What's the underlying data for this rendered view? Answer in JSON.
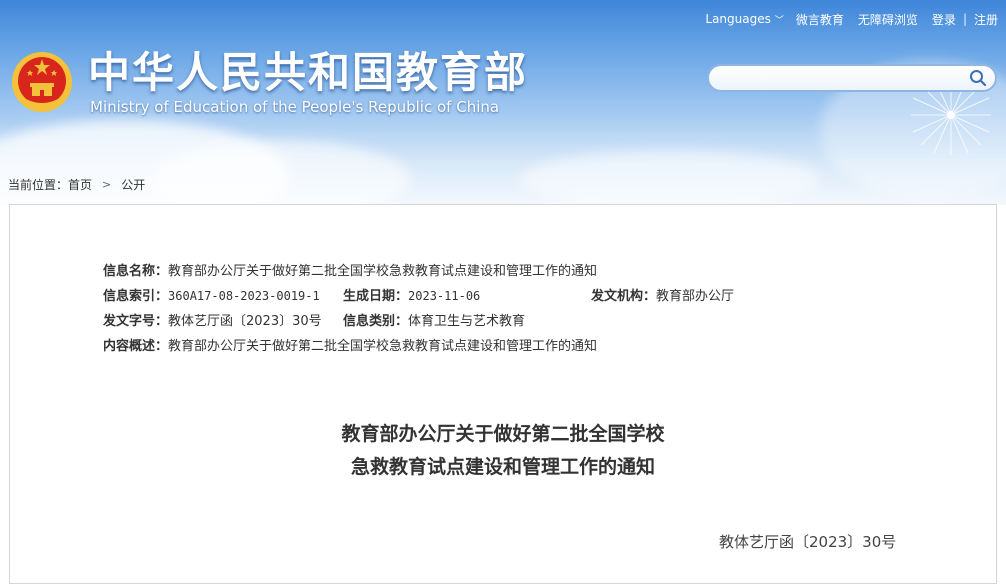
{
  "header": {
    "title_cn": "中华人民共和国教育部",
    "title_en": "Ministry of Education of the People's Republic of China",
    "nav": {
      "languages": "Languages",
      "wechat": "微言教育",
      "accessibility": "无障碍浏览",
      "login": "登录",
      "separator": "|",
      "register": "注册"
    },
    "search": {
      "placeholder": ""
    }
  },
  "breadcrumb": {
    "label": "当前位置：",
    "items": [
      "首页",
      "公开"
    ]
  },
  "meta": {
    "name_label": "信息名称：",
    "name_value": "教育部办公厅关于做好第二批全国学校急救教育试点建设和管理工作的通知",
    "index_label": "信息索引：",
    "index_value": "360A17-08-2023-0019-1",
    "date_label": "生成日期：",
    "date_value": "2023-11-06",
    "issuer_label": "发文机构：",
    "issuer_value": "教育部办公厅",
    "docno_label": "发文字号：",
    "docno_value": "教体艺厅函〔2023〕30号",
    "category_label": "信息类别：",
    "category_value": "体育卫生与艺术教育",
    "summary_label": "内容概述：",
    "summary_value": "教育部办公厅关于做好第二批全国学校急救教育试点建设和管理工作的通知"
  },
  "document": {
    "title_line1": "教育部办公厅关于做好第二批全国学校",
    "title_line2": "急救教育试点建设和管理工作的通知",
    "number": "教体艺厅函〔2023〕30号"
  },
  "colors": {
    "header_blue": "#3f86d9",
    "emblem_red": "#d8261c",
    "emblem_gold": "#f3c13a"
  }
}
